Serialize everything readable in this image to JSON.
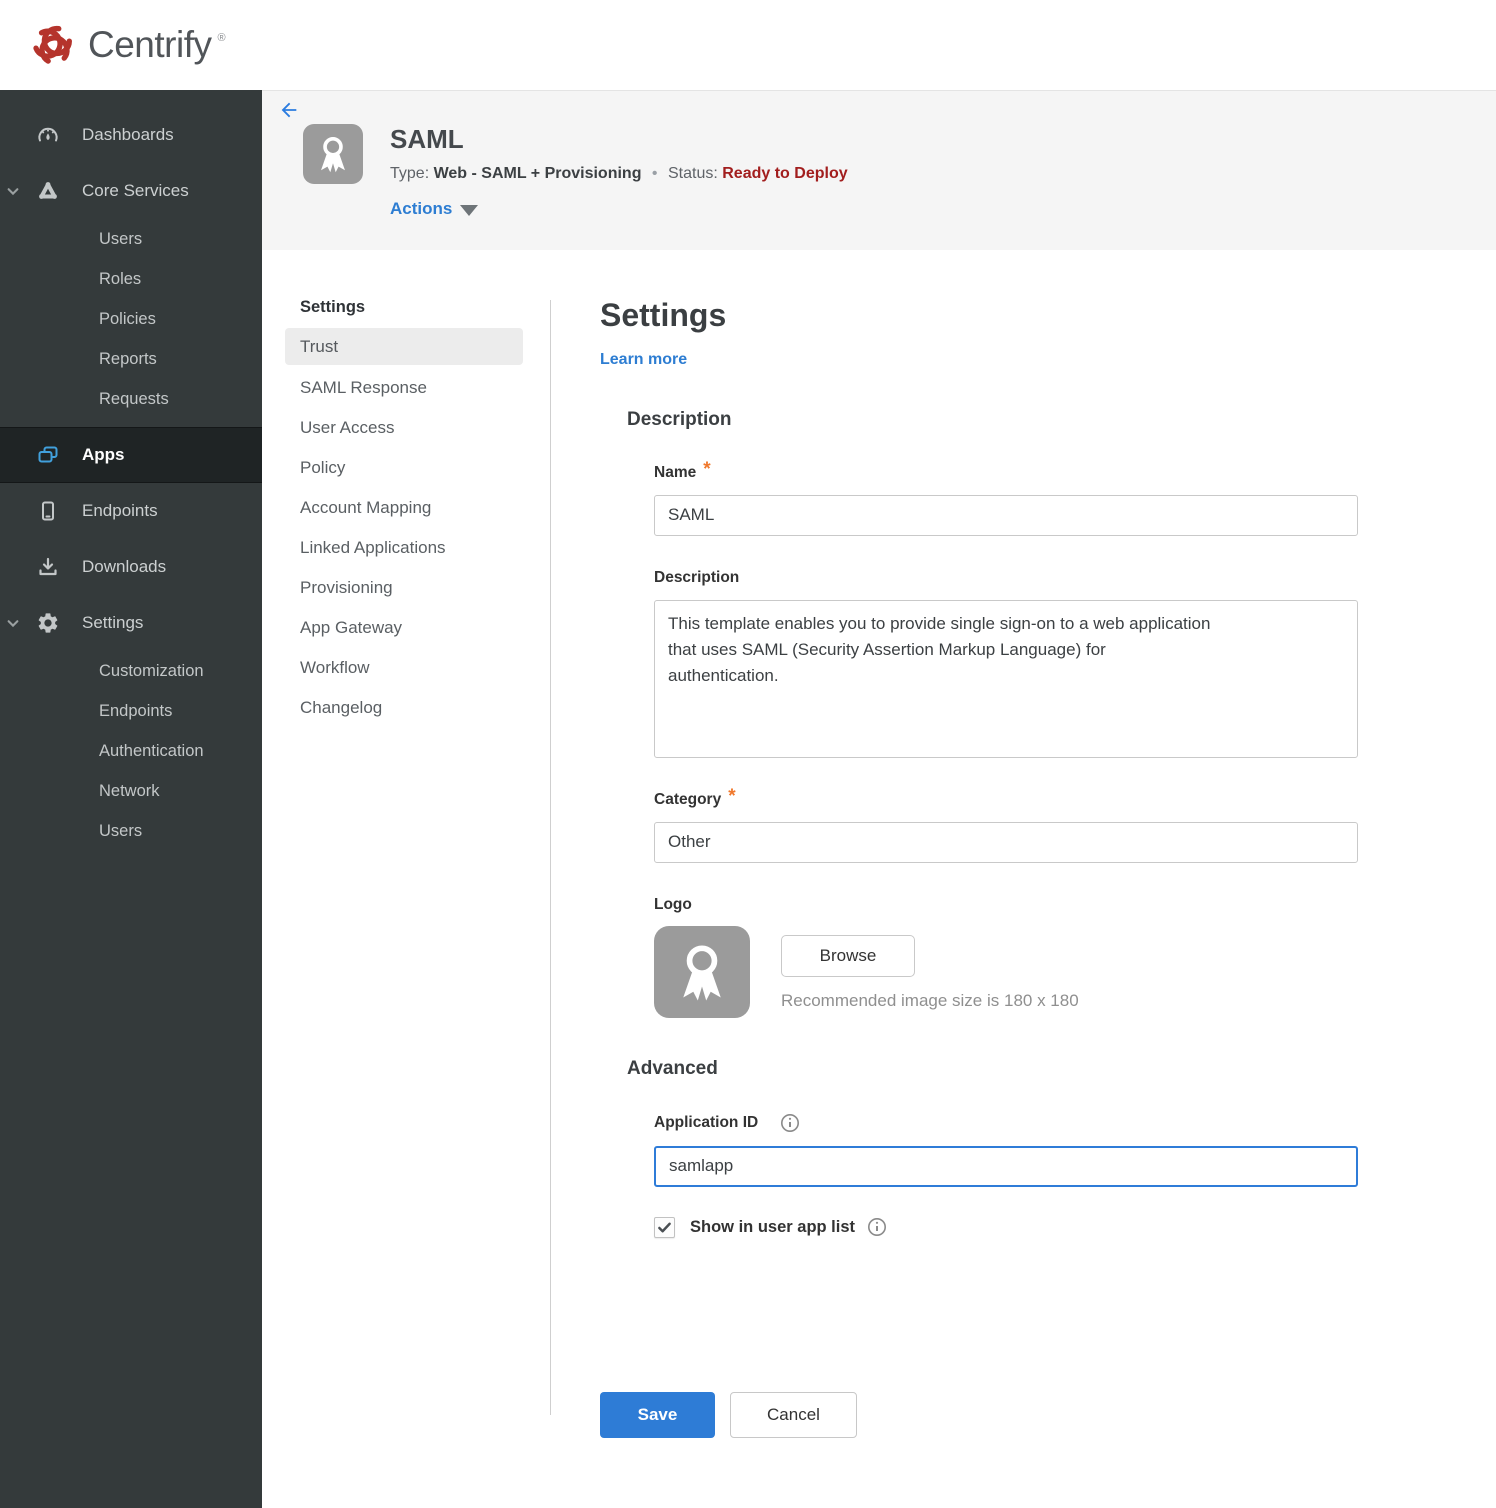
{
  "brand": {
    "name": "Centrify",
    "registered": "®"
  },
  "sidebar": {
    "items": [
      {
        "label": "Dashboards"
      },
      {
        "label": "Core Services",
        "expanded": true,
        "children": [
          "Users",
          "Roles",
          "Policies",
          "Reports",
          "Requests"
        ]
      },
      {
        "label": "Apps",
        "active": true
      },
      {
        "label": "Endpoints"
      },
      {
        "label": "Downloads"
      },
      {
        "label": "Settings",
        "expanded": true,
        "children": [
          "Customization",
          "Endpoints",
          "Authentication",
          "Network",
          "Users"
        ]
      }
    ]
  },
  "app_header": {
    "title": "SAML",
    "type_label": "Type:",
    "type_value": "Web - SAML + Provisioning",
    "separator": "•",
    "status_label": "Status:",
    "status_value": "Ready to Deploy",
    "actions_label": "Actions"
  },
  "subnav": {
    "header": "Settings",
    "active_item": "Trust",
    "items": [
      "Trust",
      "SAML Response",
      "User Access",
      "Policy",
      "Account Mapping",
      "Linked Applications",
      "Provisioning",
      "App Gateway",
      "Workflow",
      "Changelog"
    ]
  },
  "main": {
    "title": "Settings",
    "learn_more": "Learn more",
    "required_marker": "*",
    "description_section": {
      "heading": "Description",
      "name_label": "Name",
      "name_value": "SAML",
      "description_label": "Description",
      "description_value": "This template enables you to provide single sign-on to a web application\nthat uses SAML (Security Assertion Markup Language) for\nauthentication.",
      "category_label": "Category",
      "category_value": "Other",
      "logo_label": "Logo",
      "browse_label": "Browse",
      "logo_hint": "Recommended image size is 180 x 180"
    },
    "advanced_section": {
      "heading": "Advanced",
      "application_id_label": "Application ID",
      "application_id_value": "samlapp",
      "show_in_app_list_label": "Show in user app list",
      "show_in_app_list_checked": true
    },
    "save_label": "Save",
    "cancel_label": "Cancel"
  },
  "colors": {
    "accent_blue": "#2d7dd2",
    "save_blue": "#2e7cd6",
    "status_red": "#a21e1e",
    "asterisk_orange": "#f0782c",
    "sidebar_bg": "#343a3b",
    "sidebar_active_bg": "#1f2425",
    "sidebar_active_icon_blue": "#41a0dc",
    "header_band_bg": "#f5f5f5",
    "brand_red": "#b5342c"
  }
}
